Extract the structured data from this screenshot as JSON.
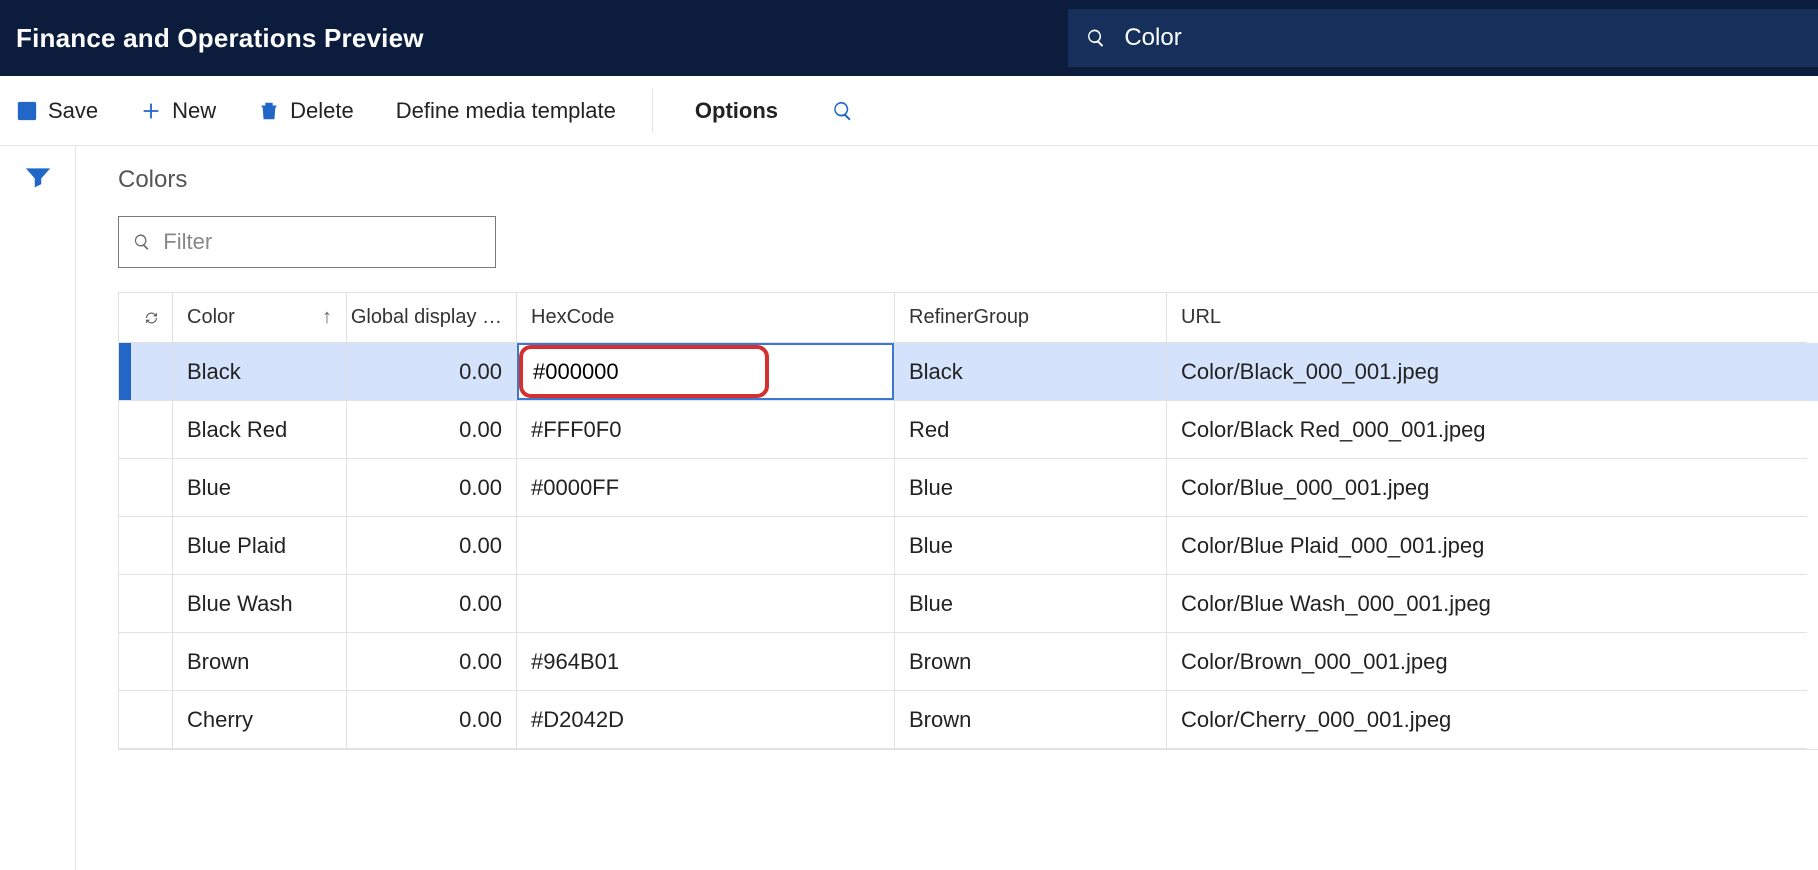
{
  "header": {
    "title": "Finance and Operations Preview"
  },
  "search": {
    "value": "Color"
  },
  "toolbar": {
    "save": "Save",
    "new": "New",
    "delete": "Delete",
    "define_media": "Define media template",
    "options": "Options"
  },
  "section_title": "Colors",
  "filter": {
    "placeholder": "Filter",
    "value": ""
  },
  "columns": {
    "color": "Color",
    "display": "Global display …",
    "hex": "HexCode",
    "refiner": "RefinerGroup",
    "url": "URL"
  },
  "rows": [
    {
      "color": "Black",
      "display": "0.00",
      "hex": "#000000",
      "refiner": "Black",
      "url": "Color/Black_000_001.jpeg",
      "selected": true,
      "editing": true
    },
    {
      "color": "Black Red",
      "display": "0.00",
      "hex": "#FFF0F0",
      "refiner": "Red",
      "url": "Color/Black Red_000_001.jpeg"
    },
    {
      "color": "Blue",
      "display": "0.00",
      "hex": "#0000FF",
      "refiner": "Blue",
      "url": "Color/Blue_000_001.jpeg"
    },
    {
      "color": "Blue Plaid",
      "display": "0.00",
      "hex": "",
      "refiner": "Blue",
      "url": "Color/Blue Plaid_000_001.jpeg"
    },
    {
      "color": "Blue Wash",
      "display": "0.00",
      "hex": "",
      "refiner": "Blue",
      "url": "Color/Blue Wash_000_001.jpeg"
    },
    {
      "color": "Brown",
      "display": "0.00",
      "hex": "#964B01",
      "refiner": "Brown",
      "url": "Color/Brown_000_001.jpeg"
    },
    {
      "color": "Cherry",
      "display": "0.00",
      "hex": "#D2042D",
      "refiner": "Brown",
      "url": "Color/Cherry_000_001.jpeg"
    }
  ]
}
